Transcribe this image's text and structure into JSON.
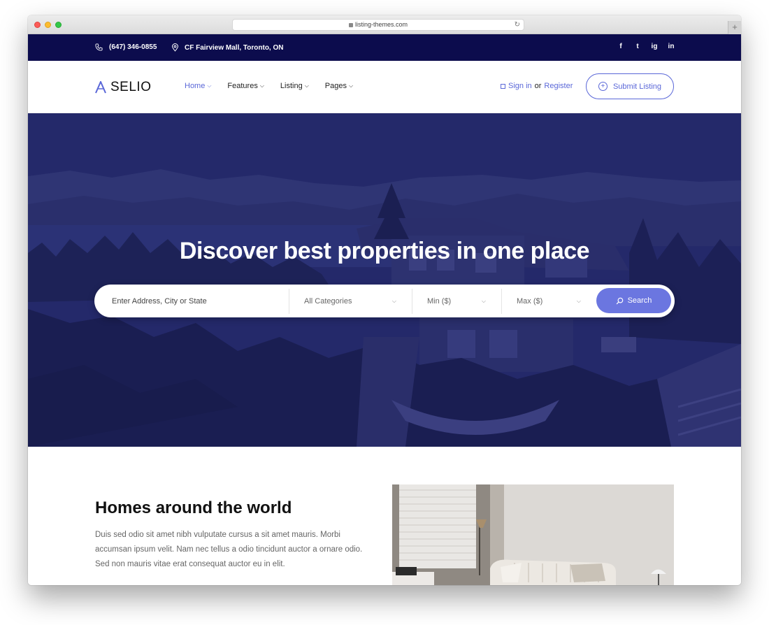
{
  "browser": {
    "url": "listing-themes.com",
    "new_tab": "+"
  },
  "topbar": {
    "phone": "(647) 346-0855",
    "address": "CF Fairview Mall, Toronto, ON",
    "social": [
      "f",
      "t",
      "ig",
      "in"
    ]
  },
  "nav": {
    "logo_mark": "A",
    "logo": "SELIO",
    "menu": [
      {
        "label": "Home",
        "active": true
      },
      {
        "label": "Features",
        "active": false
      },
      {
        "label": "Listing",
        "active": false
      },
      {
        "label": "Pages",
        "active": false
      }
    ],
    "sign_in": "Sign in",
    "or": "or",
    "register": "Register",
    "submit": "Submit Listing"
  },
  "hero": {
    "title": "Discover best properties in one place",
    "search": {
      "address_placeholder": "Enter Address, City or State",
      "category": "All Categories",
      "min": "Min ($)",
      "max": "Max ($)",
      "button": "Search"
    }
  },
  "section": {
    "title": "Homes around the world",
    "text": "Duis sed odio sit amet nibh vulputate cursus a sit amet mauris. Morbi accumsan ipsum velit. Nam nec tellus a odio tincidunt auctor a ornare odio. Sed non mauris vitae erat consequat auctor eu in elit."
  },
  "colors": {
    "accent": "#5a67d8",
    "topbar": "#0c0c4d",
    "hero_overlay": "#232866"
  }
}
